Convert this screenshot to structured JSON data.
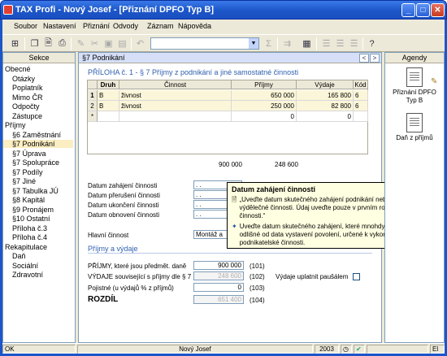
{
  "window": {
    "title": "TAX Profi - Nový Josef - [Přiznání DPFO Typ B]"
  },
  "menu": [
    "Soubor",
    "Nastavení",
    "Přiznání",
    "Odvody",
    "Záznam",
    "Nápověda"
  ],
  "left": {
    "header": "Sekce",
    "items": [
      {
        "label": "Obecné",
        "level": 1
      },
      {
        "label": "Otázky",
        "level": 2
      },
      {
        "label": "Poplatník",
        "level": 2
      },
      {
        "label": "Mimo ČR",
        "level": 2
      },
      {
        "label": "Odpočty",
        "level": 2
      },
      {
        "label": "Zástupce",
        "level": 2
      },
      {
        "label": "Příjmy",
        "level": 1
      },
      {
        "label": "§6 Zaměstnání",
        "level": 2
      },
      {
        "label": "§7 Podnikání",
        "level": 2,
        "selected": true
      },
      {
        "label": "§7 Úprava",
        "level": 2
      },
      {
        "label": "§7 Spolupráce",
        "level": 2
      },
      {
        "label": "§7 Podíly",
        "level": 2
      },
      {
        "label": "§7 Jiné",
        "level": 2
      },
      {
        "label": "§7 Tabulka JÚ",
        "level": 2
      },
      {
        "label": "§8 Kapitál",
        "level": 2
      },
      {
        "label": "§9 Pronájem",
        "level": 2
      },
      {
        "label": "§10 Ostatní",
        "level": 2
      },
      {
        "label": "Příloha č.3",
        "level": 2
      },
      {
        "label": "Příloha č.4",
        "level": 2
      },
      {
        "label": "Rekapitulace",
        "level": 1
      },
      {
        "label": "Daň",
        "level": 2
      },
      {
        "label": "Sociální",
        "level": 2
      },
      {
        "label": "Zdravotní",
        "level": 2
      }
    ]
  },
  "main": {
    "header": "§7 Podnikání",
    "section_title": "PŘÍLOHA č. 1 - § 7 Příjmy z podnikání a jiné samostatné činnosti",
    "table": {
      "columns": [
        "Druh",
        "Činnost",
        "Příjmy",
        "Výdaje",
        "Kód"
      ],
      "rows": [
        {
          "num": "1",
          "druh": "B",
          "cinnost": "živnost",
          "prijmy": "650 000",
          "vydaje": "165 800",
          "kod": "6"
        },
        {
          "num": "2",
          "druh": "B",
          "cinnost": "živnost",
          "prijmy": "250 000",
          "vydaje": "82 800",
          "kod": "6"
        },
        {
          "num": "*",
          "druh": "",
          "cinnost": "",
          "prijmy": "0",
          "vydaje": "0",
          "kod": ""
        }
      ],
      "total_prijmy": "900 000",
      "total_vydaje": "248 600"
    },
    "dates": {
      "zahajeni": "Datum zahájení činnosti",
      "preruseni": "Datum přerušení činnosti",
      "ukonceni": "Datum ukončení činnosti",
      "obnoveni": "Datum obnovení činnosti",
      "placeholder": " .  ."
    },
    "hlavni_cinnost_label": "Hlavní činnost",
    "hlavni_cinnost_value": "Montáž a",
    "prijmy_vydaje_title": "Příjmy a výdaje",
    "prijmy_label": "PŘÍJMY, které jsou předmět. daně",
    "prijmy_value": "900 000",
    "prijmy_code": "(101)",
    "vydaje_label": "VÝDAJE související s příjmy dle § 7",
    "vydaje_value": "248 600",
    "vydaje_code": "(102)",
    "pojistne_label": "Pojistné (u výdajů % z příjmů)",
    "pojistne_value": "0",
    "pojistne_code": "(103)",
    "rozdil_label": "ROZDÍL",
    "rozdil_value": "651 400",
    "rozdil_code": "(104)",
    "pausal_label": "Výdaje uplatnit paušálem"
  },
  "tooltip": {
    "title": "Datum zahájení činnosti",
    "p1": "„Uveďte datum skutečného zahájení podnikání nebo jiné výdělečné činnosti. Údaj uveďte pouze v prvním roce zahájení činnosti.“",
    "p2": "Uveďte datum skutečného zahájení, které mnohdy může být odlišné od data vystavení povolení, určené k vykonávání Vaší podnikatelské činnosti."
  },
  "right": {
    "header": "Agendy",
    "items": [
      "Přiznání DPFO Typ B",
      "Daň z příjmů"
    ]
  },
  "status": {
    "left": "OK",
    "center": "Nový Josef",
    "year": "2003",
    "right": "El"
  }
}
